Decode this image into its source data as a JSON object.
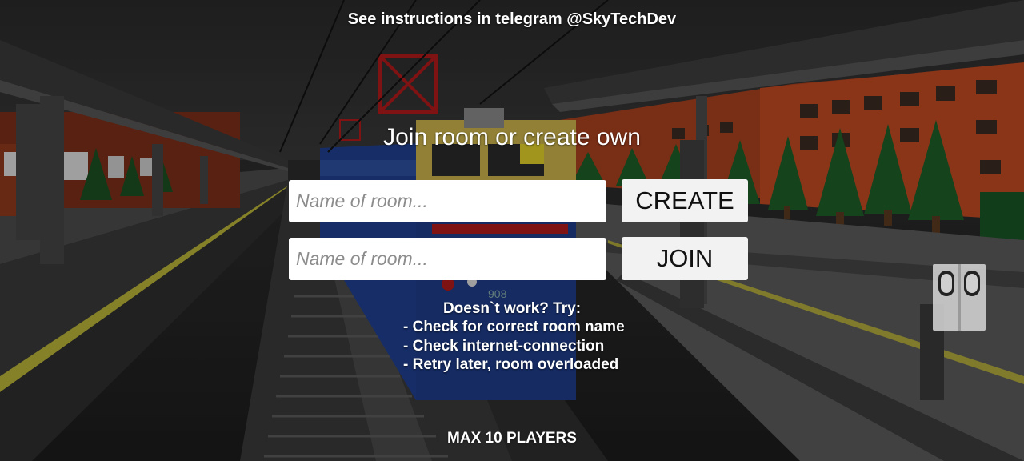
{
  "header": {
    "instructions": "See instructions in telegram @SkyTechDev"
  },
  "room": {
    "heading": "Join room or create own",
    "create_input": {
      "value": "",
      "placeholder": "Name of room..."
    },
    "join_input": {
      "value": "",
      "placeholder": "Name of room..."
    },
    "create_label": "CREATE",
    "join_label": "JOIN"
  },
  "help": {
    "title": "Doesn`t work? Try:",
    "items": [
      "- Check for correct room name",
      "- Check internet-connection",
      "- Retry later, room overloaded"
    ]
  },
  "footer": {
    "max_players": "MAX 10 PLAYERS"
  },
  "train": {
    "number": "908"
  },
  "controls": {
    "pause_icon": "pause-icon"
  },
  "colors": {
    "sky": "#262626",
    "building": "#d9562a",
    "tree": "#1e6b2a",
    "train_blue": "#1f3f8f",
    "train_yellow": "#c9b24a",
    "catenary": "#b01a1a",
    "platform_stripe": "#c8c23a",
    "button_bg": "#f2f2f2",
    "input_bg": "#ffffff"
  }
}
